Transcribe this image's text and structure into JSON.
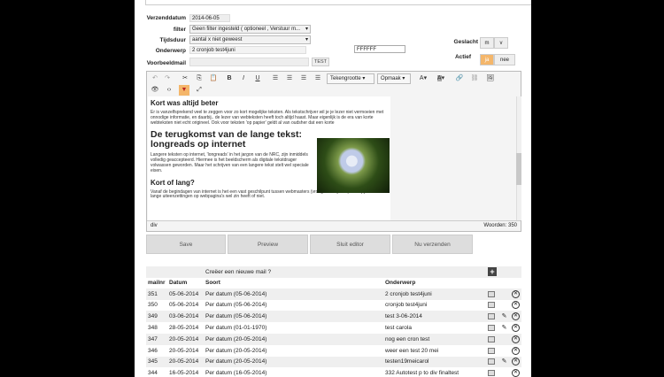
{
  "form": {
    "verzenddatum_label": "Verzenddatum",
    "verzenddatum_value": "2014-06-05",
    "filter_label": "filter",
    "filter_value": "Geen filter ingesteld ( optioneel , Verstuur m...",
    "tijdsduur_label": "Tijdsduur",
    "tijdsduur_value": "aantal x niet geweest",
    "onderwerp_label": "Onderwerp",
    "onderwerp_value": "2 cronjob test4juni",
    "color_value": "FFFFFF",
    "voorbeeldmail_label": "Voorbeeldmail",
    "test_button": "TEST",
    "geslacht_label": "Geslacht",
    "geslacht_m": "m",
    "geslacht_v": "v",
    "actief_label": "Actief",
    "actief_ja": "ja",
    "actief_nee": "nee"
  },
  "toolbar": {
    "bold": "B",
    "italic": "I",
    "underline": "U",
    "fontsize": "Tekengrootte",
    "format": "Opmaak",
    "textcolor": "A",
    "bgcolor": "A"
  },
  "editor": {
    "h1": "Kort was altijd beter",
    "p1": "Er is vanzelfsprekend veel te zeggen voor zo kort mogelijke teksten. Als tekstschrijver wil je je lezer niet vermoeien met onnodige informatie, en daarbij.. de lezer van webteksten heeft toch altijd haast. Maar eigenlijk is de era van korte webteksten niet echt origineel. Ook voor teksten 'op papier' geldt al van oudsher dat een korte",
    "h2": "De terugkomst van de lange tekst: longreads op internet",
    "p2": "Langere teksten op internet, 'longreads' in het jargon van de NRC, zijn inmiddels volledig geaccepteerd. Hiermee is het beeldscherm als digitale tekstdrager volwassen geworden. Maar het schrijven van een langere tekst stelt wel speciale eisen.",
    "h3": "Kort of lang?",
    "p3": "Vanaf de begindagen van internet is het een vast geschilpunt tussen webmasters (vroeger had je die) en copywriters: of lange uiteenzettingen op webpagina's wel zin heeft of niet.",
    "path": "div",
    "wordcount": "Woorden: 350"
  },
  "actions": {
    "save": "Save",
    "preview": "Preview",
    "close": "Sluit editor",
    "send": "Nu verzenden"
  },
  "table": {
    "create_label": "Creëer een nieuwe mail ?",
    "headers": [
      "mailnr",
      "Datum",
      "Soort",
      "Onderwerp"
    ],
    "rows": [
      {
        "nr": "351",
        "datum": "05-06-2014",
        "soort": "Per datum (05-06-2014)",
        "onderwerp": "2 cronjob test4juni",
        "edit": false
      },
      {
        "nr": "350",
        "datum": "05-06-2014",
        "soort": "Per datum (05-06-2014)",
        "onderwerp": "cronjob test4juni",
        "edit": false
      },
      {
        "nr": "349",
        "datum": "03-06-2014",
        "soort": "Per datum (05-06-2014)",
        "onderwerp": "test 3-06-2014",
        "edit": true
      },
      {
        "nr": "348",
        "datum": "28-05-2014",
        "soort": "Per datum (01-01-1970)",
        "onderwerp": "test carola",
        "edit": true
      },
      {
        "nr": "347",
        "datum": "20-05-2014",
        "soort": "Per datum (20-05-2014)",
        "onderwerp": "nog een cron test",
        "edit": false
      },
      {
        "nr": "346",
        "datum": "20-05-2014",
        "soort": "Per datum (20-05-2014)",
        "onderwerp": "weer een test 20 mei",
        "edit": false
      },
      {
        "nr": "345",
        "datum": "20-05-2014",
        "soort": "Per datum (20-05-2014)",
        "onderwerp": "testen19meicarol",
        "edit": true
      },
      {
        "nr": "344",
        "datum": "16-05-2014",
        "soort": "Per datum (16-05-2014)",
        "onderwerp": "332 Autotest p to div finaltest",
        "edit": false
      }
    ]
  },
  "colors": {
    "accent": "#f4b66a",
    "background": "#000000"
  }
}
